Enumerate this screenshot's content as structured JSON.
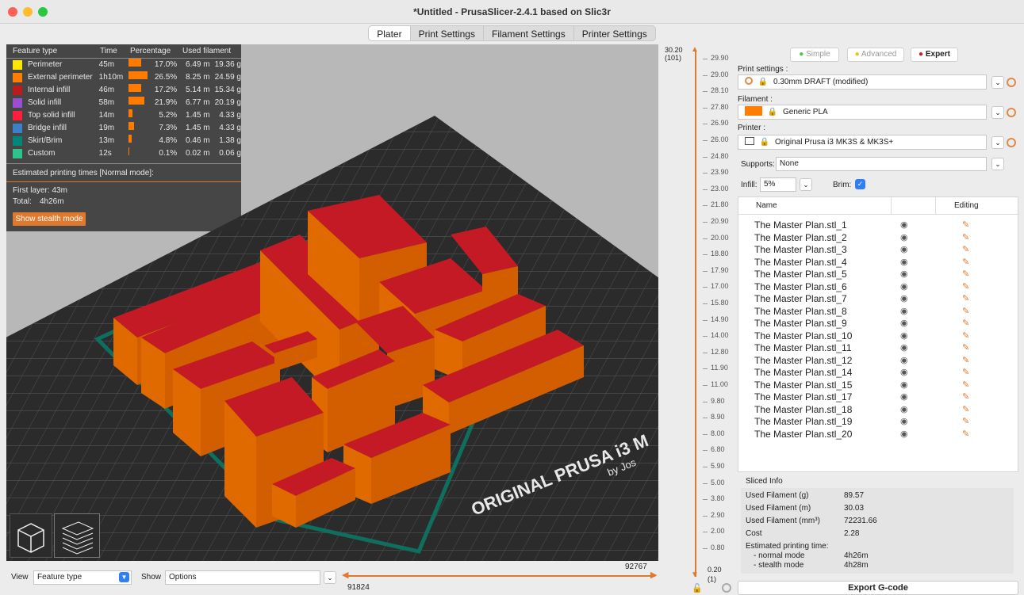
{
  "window": {
    "title": "*Untitled - PrusaSlicer-2.4.1 based on Slic3r"
  },
  "tabs": [
    "Plater",
    "Print Settings",
    "Filament Settings",
    "Printer Settings"
  ],
  "legend": {
    "headers": [
      "Feature type",
      "Time",
      "Percentage",
      "Used filament"
    ],
    "rows": [
      {
        "name": "Perimeter",
        "color": "#ffe600",
        "time": "45m",
        "pct": "17.0%",
        "pct_value": 17.0,
        "len": "6.49 m",
        "weight": "19.36 g"
      },
      {
        "name": "External perimeter",
        "color": "#ff7d00",
        "time": "1h10m",
        "pct": "26.5%",
        "pct_value": 26.5,
        "len": "8.25 m",
        "weight": "24.59 g"
      },
      {
        "name": "Internal infill",
        "color": "#b81c1c",
        "time": "46m",
        "pct": "17.2%",
        "pct_value": 17.2,
        "len": "5.14 m",
        "weight": "15.34 g"
      },
      {
        "name": "Solid infill",
        "color": "#9a4fd0",
        "time": "58m",
        "pct": "21.9%",
        "pct_value": 21.9,
        "len": "6.77 m",
        "weight": "20.19 g"
      },
      {
        "name": "Top solid infill",
        "color": "#ff1e3c",
        "time": "14m",
        "pct": "5.2%",
        "pct_value": 5.2,
        "len": "1.45 m",
        "weight": "4.33 g"
      },
      {
        "name": "Bridge infill",
        "color": "#3d7fc8",
        "time": "19m",
        "pct": "7.3%",
        "pct_value": 7.3,
        "len": "1.45 m",
        "weight": "4.33 g"
      },
      {
        "name": "Skirt/Brim",
        "color": "#00877a",
        "time": "13m",
        "pct": "4.8%",
        "pct_value": 4.8,
        "len": "0.46 m",
        "weight": "1.38 g"
      },
      {
        "name": "Custom",
        "color": "#2ec28c",
        "time": "12s",
        "pct": "0.1%",
        "pct_value": 0.1,
        "len": "0.02 m",
        "weight": "0.06 g"
      }
    ],
    "estimate_title": "Estimated printing times [Normal mode]:",
    "first_layer": "First layer: 43m",
    "total_label": "Total:",
    "total_value": "4h26m",
    "stealth_button": "Show stealth mode"
  },
  "bed": {
    "brand_text": "ORIGINAL PRUSA i3 M",
    "by_text": "by Jos"
  },
  "bottom": {
    "view_label": "View",
    "view_value": "Feature type",
    "show_label": "Show",
    "show_value": "Options",
    "hslider_left": "91824",
    "hslider_right": "92767"
  },
  "vslider": {
    "top_value": "30.20",
    "top_layer": "(101)",
    "bottom_value": "0.20",
    "bottom_layer": "(1)",
    "ticks": [
      "29.90",
      "29.00",
      "28.10",
      "27.80",
      "26.90",
      "26.00",
      "24.80",
      "23.90",
      "23.00",
      "21.80",
      "20.90",
      "20.00",
      "18.80",
      "17.90",
      "17.00",
      "15.80",
      "14.90",
      "14.00",
      "12.80",
      "11.90",
      "11.00",
      "9.80",
      "8.90",
      "8.00",
      "6.80",
      "5.90",
      "5.00",
      "3.80",
      "2.90",
      "2.00",
      "0.80"
    ]
  },
  "modes": {
    "simple": "Simple",
    "advanced": "Advanced",
    "expert": "Expert"
  },
  "settings": {
    "print_label": "Print settings :",
    "print_value": "0.30mm DRAFT (modified)",
    "filament_label": "Filament :",
    "filament_value": "Generic PLA",
    "printer_label": "Printer :",
    "printer_value": "Original Prusa i3 MK3S & MK3S+",
    "supports_label": "Supports:",
    "supports_value": "None",
    "infill_label": "Infill:",
    "infill_value": "5%",
    "brim_label": "Brim:"
  },
  "objects": {
    "col_name": "Name",
    "col_editing": "Editing",
    "items": [
      "The Master Plan.stl_1",
      "The Master Plan.stl_2",
      "The Master Plan.stl_3",
      "The Master Plan.stl_4",
      "The Master Plan.stl_5",
      "The Master Plan.stl_6",
      "The Master Plan.stl_7",
      "The Master Plan.stl_8",
      "The Master Plan.stl_9",
      "The Master Plan.stl_10",
      "The Master Plan.stl_11",
      "The Master Plan.stl_12",
      "The Master Plan.stl_14",
      "The Master Plan.stl_15",
      "The Master Plan.stl_17",
      "The Master Plan.stl_18",
      "The Master Plan.stl_19",
      "The Master Plan.stl_20"
    ]
  },
  "sliced": {
    "title": "Sliced Info",
    "rows": [
      {
        "label": "Used Filament (g)",
        "value": "89.57"
      },
      {
        "label": "Used Filament (m)",
        "value": "30.03"
      },
      {
        "label": "Used Filament (mm³)",
        "value": "72231.66"
      },
      {
        "label": "Cost",
        "value": "2.28"
      }
    ],
    "est_label": "Estimated printing time:",
    "normal_label": "- normal mode",
    "normal_value": "4h26m",
    "stealth_label": "- stealth mode",
    "stealth_value": "4h28m"
  },
  "export_button": "Export G-code"
}
